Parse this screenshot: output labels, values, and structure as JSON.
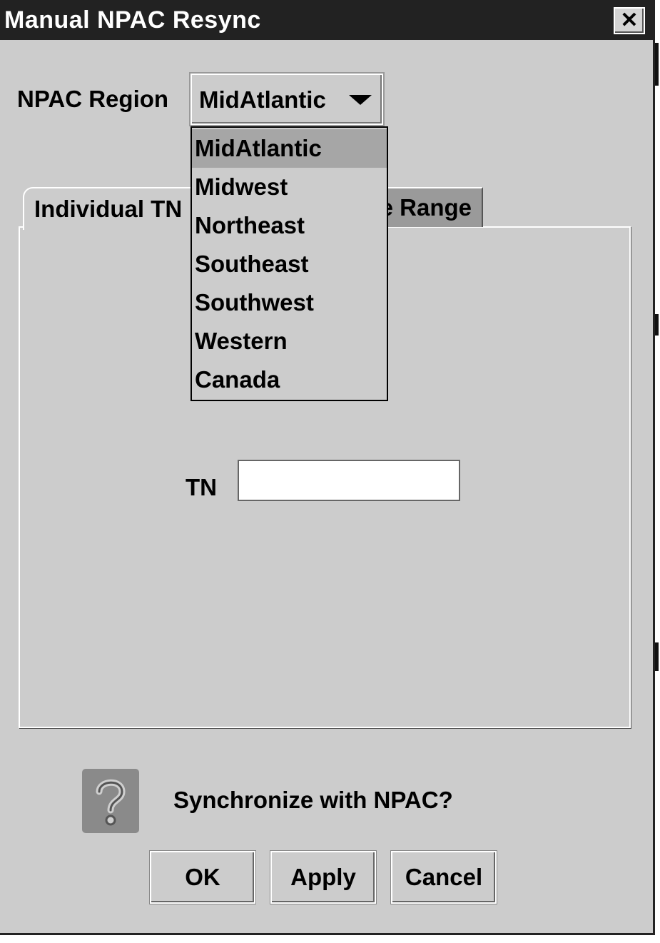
{
  "window": {
    "title": "Manual NPAC Resync",
    "close_glyph": "✕"
  },
  "region": {
    "label": "NPAC Region",
    "selected": "MidAtlantic",
    "options": [
      "MidAtlantic",
      "Midwest",
      "Northeast",
      "Southeast",
      "Southwest",
      "Western",
      "Canada"
    ]
  },
  "tabs": {
    "individual_label": "Individual TN",
    "range_label_visible": "e Range"
  },
  "tn": {
    "label": "TN",
    "value": ""
  },
  "confirm": {
    "icon": "question-icon",
    "message": "Synchronize with NPAC?"
  },
  "buttons": {
    "ok": "OK",
    "apply": "Apply",
    "cancel": "Cancel"
  },
  "colors": {
    "dialog_bg": "#cccccc",
    "titlebar_bg": "#222222",
    "selected_item_bg": "#a6a6a6",
    "inactive_tab_bg": "#9a9a9a"
  }
}
